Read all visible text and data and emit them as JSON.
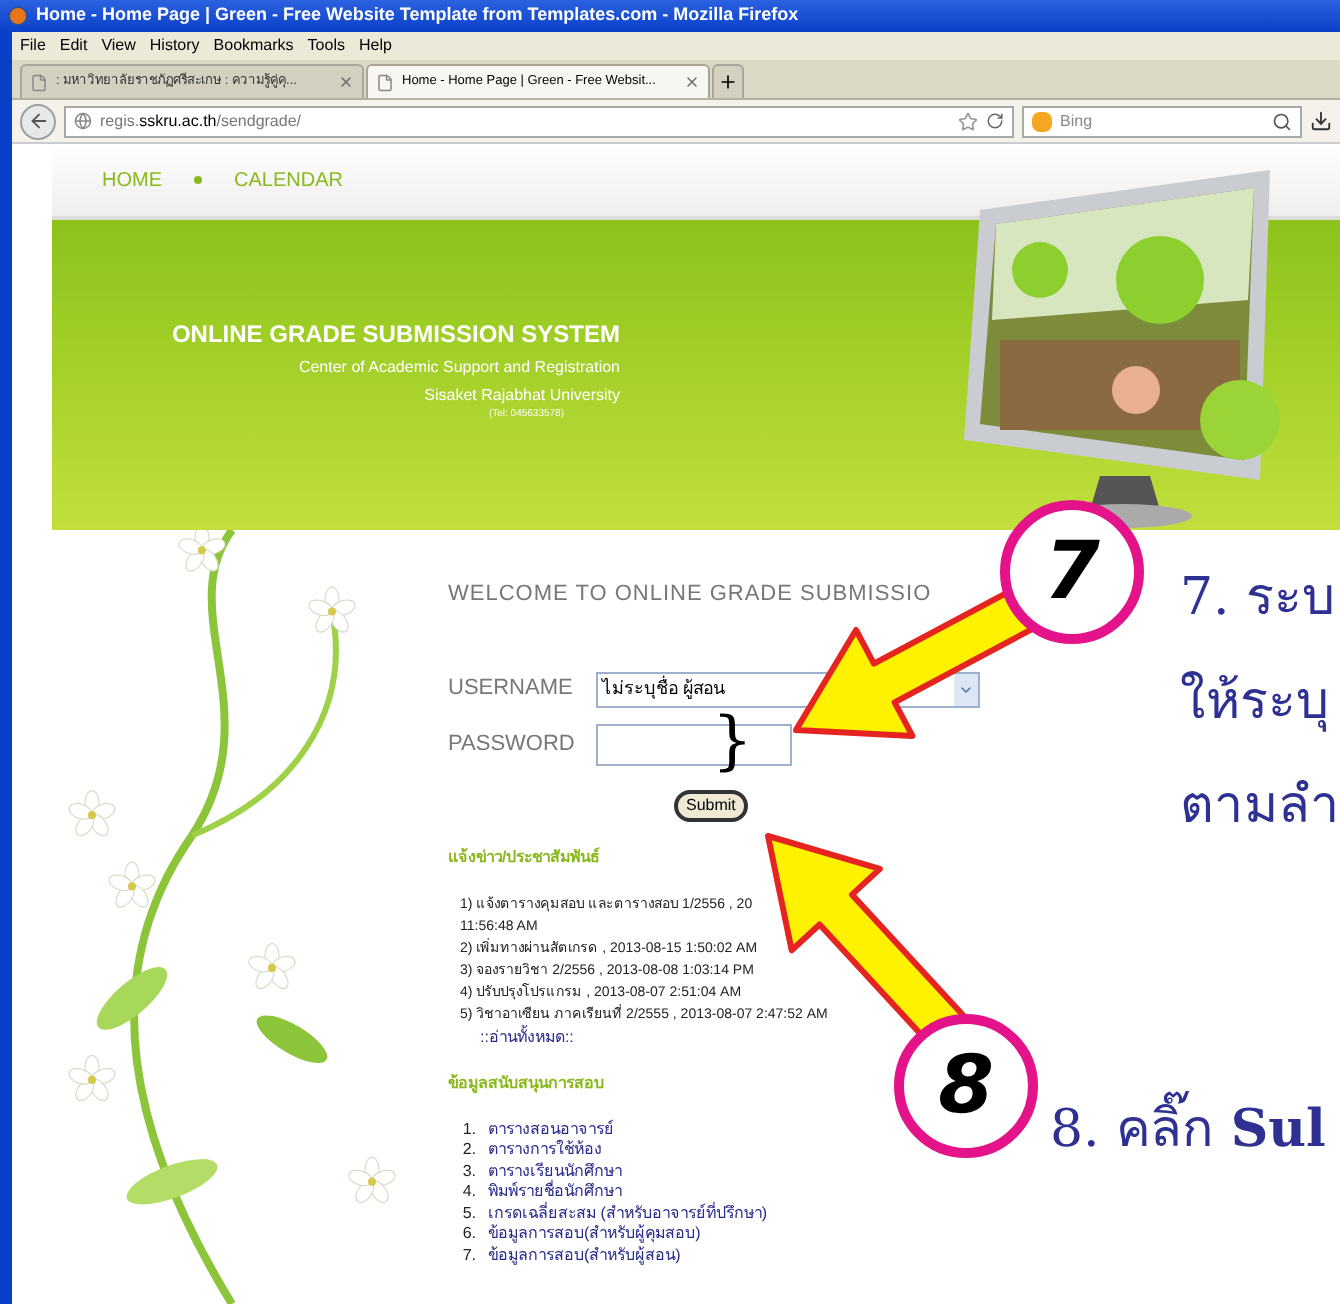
{
  "window": {
    "title": "Home - Home Page | Green - Free Website Template from Templates.com - Mozilla Firefox"
  },
  "menu": [
    "File",
    "Edit",
    "View",
    "History",
    "Bookmarks",
    "Tools",
    "Help"
  ],
  "tabs": [
    {
      "label": ": มหาวิทยาลัยราชภัฏศรีสะเกษ : ความรู้คู่คุ...",
      "selected": false
    },
    {
      "label": "Home - Home Page | Green - Free Websit...",
      "selected": true
    }
  ],
  "address": {
    "prefix": "regis.",
    "domain": "sskru.ac.th",
    "path": "/sendgrade/"
  },
  "search": {
    "placeholder": "Bing"
  },
  "nav": [
    "HOME",
    "CALENDAR"
  ],
  "banner": {
    "title": "ONLINE GRADE SUBMISSION SYSTEM",
    "lines": [
      "Center of Academic Support and Registration",
      "Sisaket Rajabhat University"
    ],
    "tel": "(Tel: 045633578)"
  },
  "login": {
    "heading": "WELCOME TO ONLINE GRADE SUBMISSIO",
    "username_label": "USERNAME",
    "username_value": "ไม่ระบุชื่อ ผู้สอน",
    "password_label": "PASSWORD",
    "submit": "Submit"
  },
  "news": {
    "title": "แจ้งข่าว/ประชาสัมพันธ์",
    "items": [
      {
        "lines": [
          "1) แจ้งตารางคุมสอบ และตารางสอบ 1/2556 , 20",
          "11:56:48 AM"
        ]
      },
      {
        "lines": [
          "2) เพิ่มทางผ่านสัตเกรด , 2013-08-15 1:50:02 AM"
        ]
      },
      {
        "lines": [
          "3) จองรายวิชา 2/2556 , 2013-08-08 1:03:14 PM"
        ]
      },
      {
        "lines": [
          "4) ปรับปรุงโปรแกรม , 2013-08-07 2:51:04 AM"
        ]
      },
      {
        "lines": [
          "5) วิชาอาเซียน ภาคเรียนที่ 2/2555 , 2013-08-07 2:47:52 AM"
        ]
      }
    ],
    "read_more": "::อ่านทั้งหมด::"
  },
  "support": {
    "title": "ข้อมูลสนับสนุนการสอบ",
    "items": [
      {
        "number": "1.",
        "text": "ตารางสอนอาจารย์"
      },
      {
        "number": "2.",
        "text": "ตารางการใช้ห้อง"
      },
      {
        "number": "3.",
        "text": "ตารางเรียนนักศึกษา"
      },
      {
        "number": "4.",
        "text": "พิมพ์รายชื่อนักศึกษา"
      },
      {
        "number": "5.",
        "text": "เกรดเฉลี่ยสะสม (สำหรับอาจารย์ที่ปรึกษา)"
      },
      {
        "number": "6.",
        "text": "ข้อมูลการสอบ(สำหรับผู้คุมสอบ)"
      },
      {
        "number": "7.",
        "text": "ข้อมูลการสอบ(สำหรับผู้สอน)"
      }
    ]
  },
  "brace": "}",
  "annotations": [
    {
      "number": "7",
      "lines": [
        "7. ระบ",
        "ให้ระบุ",
        "ตามลำ"
      ]
    },
    {
      "number": "8",
      "lines": [
        "8. คลิ๊ก **Sul**"
      ]
    }
  ]
}
